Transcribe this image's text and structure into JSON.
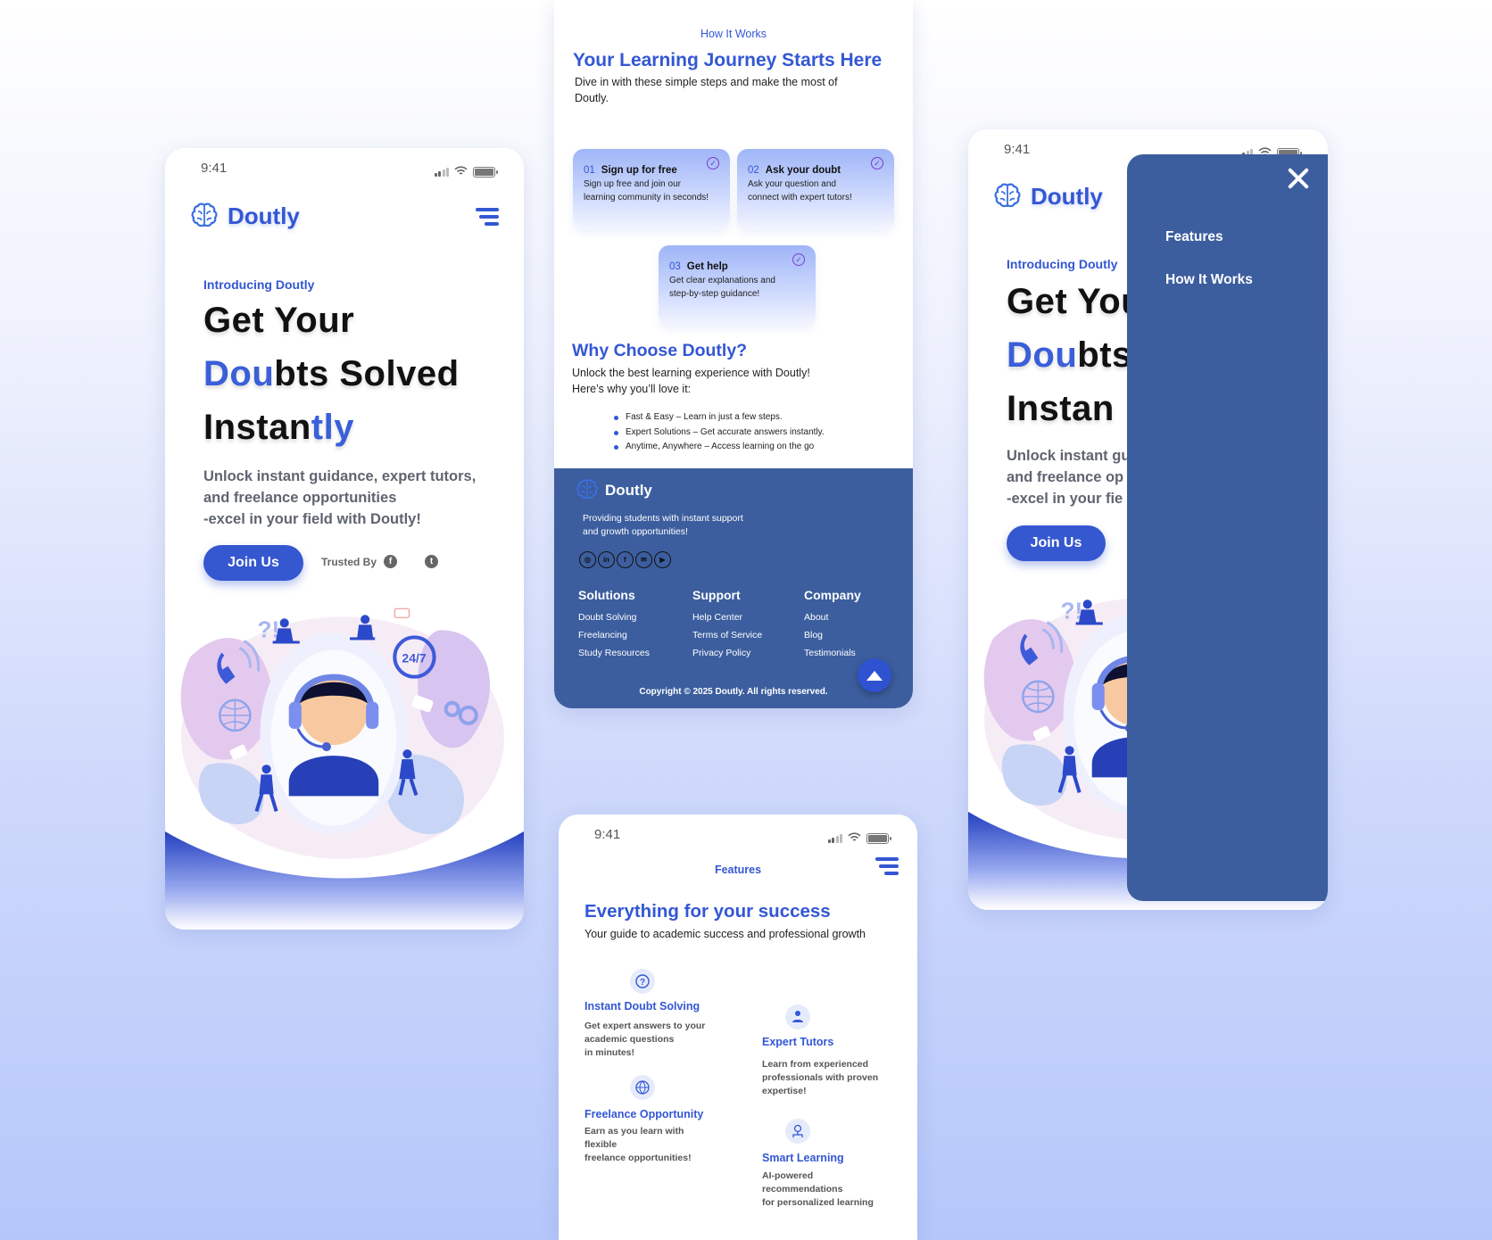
{
  "status": {
    "time": "9:41"
  },
  "brand": {
    "name": "Doutly"
  },
  "hero": {
    "intro": "Introducing Doutly",
    "line1": "Get Your",
    "line2_accent": "Dou",
    "line2_rest": "bts Solved",
    "line3_start": "Instan",
    "line3_accent": "tly",
    "subtitle1": "Unlock instant guidance, expert tutors,",
    "subtitle2": "and freelance opportunities",
    "subtitle3": "-excel in your field with Doutly!",
    "join_label": "Join Us",
    "trusted_label": "Trusted By",
    "trusted_icons": [
      "facebook-icon",
      "windows-icon",
      "twitter-icon"
    ]
  },
  "how": {
    "eyebrow": "How It Works",
    "title": "Your Learning Journey  Starts Here",
    "desc1": "Dive in with these simple steps and make the most of",
    "desc2": "Doutly.",
    "steps": [
      {
        "num": "01",
        "title": "Sign up for free",
        "d1": "Sign up free and join our",
        "d2": "learning community in seconds!"
      },
      {
        "num": "02",
        "title": "Ask your doubt",
        "d1": "Ask your question and",
        "d2": "connect with expert tutors!"
      },
      {
        "num": "03",
        "title": "Get help",
        "d1": "Get clear explanations and",
        "d2": "step-by-step guidance!"
      }
    ]
  },
  "why": {
    "title": "Why Choose Doutly?",
    "desc1": "Unlock the best learning experience with Doutly!",
    "desc2": "Here’s why you’ll love it:",
    "bullets": [
      "Fast & Easy – Learn in just a few steps.",
      "Expert Solutions – Get accurate answers instantly.",
      "Anytime, Anywhere – Access learning on the go"
    ]
  },
  "footer": {
    "tagline1": "Providing students with instant support",
    "tagline2": "and growth opportunities!",
    "socials": [
      "instagram-icon",
      "linkedin-icon",
      "facebook-icon",
      "mail-icon",
      "youtube-icon"
    ],
    "cols": [
      {
        "title": "Solutions",
        "links": [
          "Doubt Solving",
          "Freelancing",
          "Study Resources"
        ]
      },
      {
        "title": "Support",
        "links": [
          "Help Center",
          "Terms of Service",
          "Privacy Policy"
        ]
      },
      {
        "title": "Company",
        "links": [
          "About",
          "Blog",
          "Testimonials"
        ]
      }
    ],
    "copyright": "Copyright © 2025 Doutly. All rights reserved."
  },
  "features": {
    "nav_title": "Features",
    "title": "Everything for your success",
    "desc": "Your guide to academic success and professional growth",
    "items": [
      {
        "title": "Instant Doubt Solving",
        "lines": [
          "Get expert answers to your",
          " academic questions",
          "in minutes!"
        ],
        "icon": "question-icon"
      },
      {
        "title": "Expert Tutors",
        "lines": [
          "Learn from experienced",
          "professionals with proven",
          "expertise!"
        ],
        "icon": "tutor-icon"
      },
      {
        "title": "Freelance Opportunity",
        "lines": [
          "Earn as you learn with",
          "flexible",
          "freelance opportunities!"
        ],
        "icon": "globe-icon"
      },
      {
        "title": "Smart Learning",
        "lines": [
          "AI-powered",
          "recommendations",
          "for personalized learning"
        ],
        "icon": "ai-icon"
      }
    ]
  },
  "menu": {
    "items": [
      "Features",
      "How It Works"
    ],
    "hero_partial": {
      "line1": "Get You",
      "line2_accent": "Dou",
      "line2_rest": "bts",
      "line3": "Instan",
      "sub1": "Unlock instant gu",
      "sub2": "and freelance op",
      "sub3": "-excel in your fie"
    }
  },
  "colors": {
    "accent": "#3357d4",
    "footer": "#3c5e9e",
    "button": "#3557d0"
  }
}
